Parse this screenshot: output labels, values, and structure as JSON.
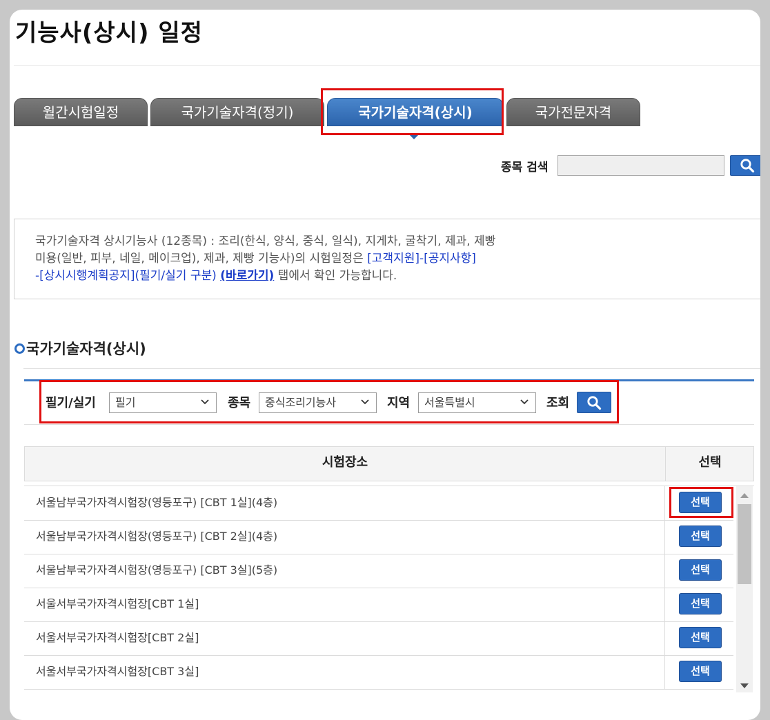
{
  "page": {
    "title": "기능사(상시) 일정"
  },
  "tabs": [
    {
      "label": "월간시험일정"
    },
    {
      "label": "국가기술자격(정기)"
    },
    {
      "label": "국가기술자격(상시)"
    },
    {
      "label": "국가전문자격"
    }
  ],
  "active_tab": "국가기술자격(상시)",
  "search": {
    "label": "종목 검색",
    "value": "",
    "placeholder": ""
  },
  "info": {
    "text1": "국가기술자격 상시기능사 (12종목) : 조리(한식, 양식, 중식, 일식), 지게차, 굴착기, 제과, 제빵",
    "text2": "미용(일반, 피부, 네일, 메이크업), 제과, 제빵 기능사)의 시험일정은 ",
    "link1": "[고객지원]-[공지사항]",
    "link2": "-[상시시행계획공지](필기/실기 구분)",
    "link3": "(바로가기)",
    "text3": " 탭에서 확인 가능합니다."
  },
  "section": {
    "title": "국가기술자격(상시)"
  },
  "filter": {
    "type_label": "필기/실기",
    "type_value": "필기",
    "subject_label": "종목",
    "subject_value": "중식조리기능사",
    "region_label": "지역",
    "region_value": "서울특별시",
    "query_label": "조회"
  },
  "table": {
    "headers": {
      "place": "시험장소",
      "select": "선택"
    },
    "rows": [
      {
        "place": "서울남부국가자격시험장(영등포구) [CBT 1실](4층)",
        "button": "선택"
      },
      {
        "place": "서울남부국가자격시험장(영등포구) [CBT 2실](4층)",
        "button": "선택"
      },
      {
        "place": "서울남부국가자격시험장(영등포구) [CBT 3실](5층)",
        "button": "선택"
      },
      {
        "place": "서울서부국가자격시험장[CBT 1실]",
        "button": "선택"
      },
      {
        "place": "서울서부국가자격시험장[CBT 2실]",
        "button": "선택"
      },
      {
        "place": "서울서부국가자격시험장[CBT 3실]",
        "button": "선택"
      }
    ]
  },
  "colors": {
    "accent": "#2d6dc2",
    "highlight": "#e01010",
    "tab_inactive": "#6b6b6b"
  },
  "icons": {
    "search": "search-icon",
    "dropdown": "chevron-down-icon",
    "scroll_up": "scroll-up-icon",
    "scroll_down": "scroll-down-icon"
  }
}
